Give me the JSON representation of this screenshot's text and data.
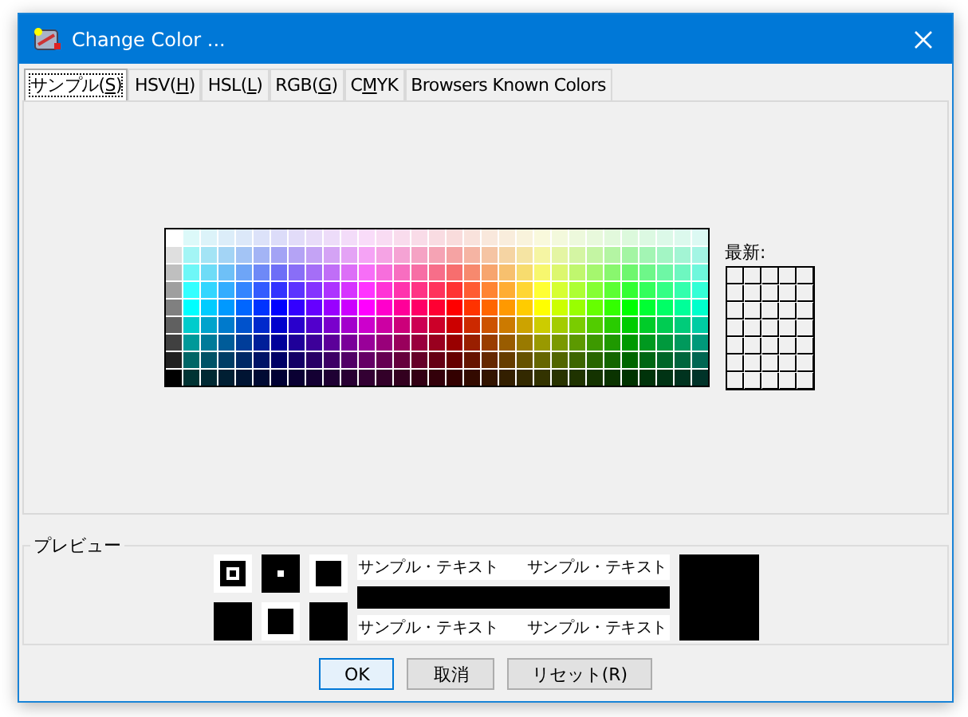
{
  "window": {
    "title": "Change Color ..."
  },
  "tabs": [
    {
      "text": "サンプル(",
      "key": "S",
      "after": ")",
      "selected": true
    },
    {
      "text": "HSV(",
      "key": "H",
      "after": ")",
      "selected": false
    },
    {
      "text": "HSL(",
      "key": "L",
      "after": ")",
      "selected": false
    },
    {
      "text": "RGB(",
      "key": "G",
      "after": ")",
      "selected": false
    },
    {
      "text": "C",
      "key": "M",
      "after": "YK",
      "selected": false
    },
    {
      "text": "Browsers Known Colors",
      "selected": false
    }
  ],
  "recent": {
    "label": "最新:"
  },
  "preview": {
    "title": "プレビュー",
    "samples": [
      "サンプル・テキスト",
      "サンプル・テキスト",
      "サンプル・テキスト",
      "サンプル・テキスト"
    ]
  },
  "buttons": [
    {
      "label": "OK",
      "default": true
    },
    {
      "label": "取消",
      "default": false
    },
    {
      "label": "リセット(R)",
      "default": false
    }
  ]
}
